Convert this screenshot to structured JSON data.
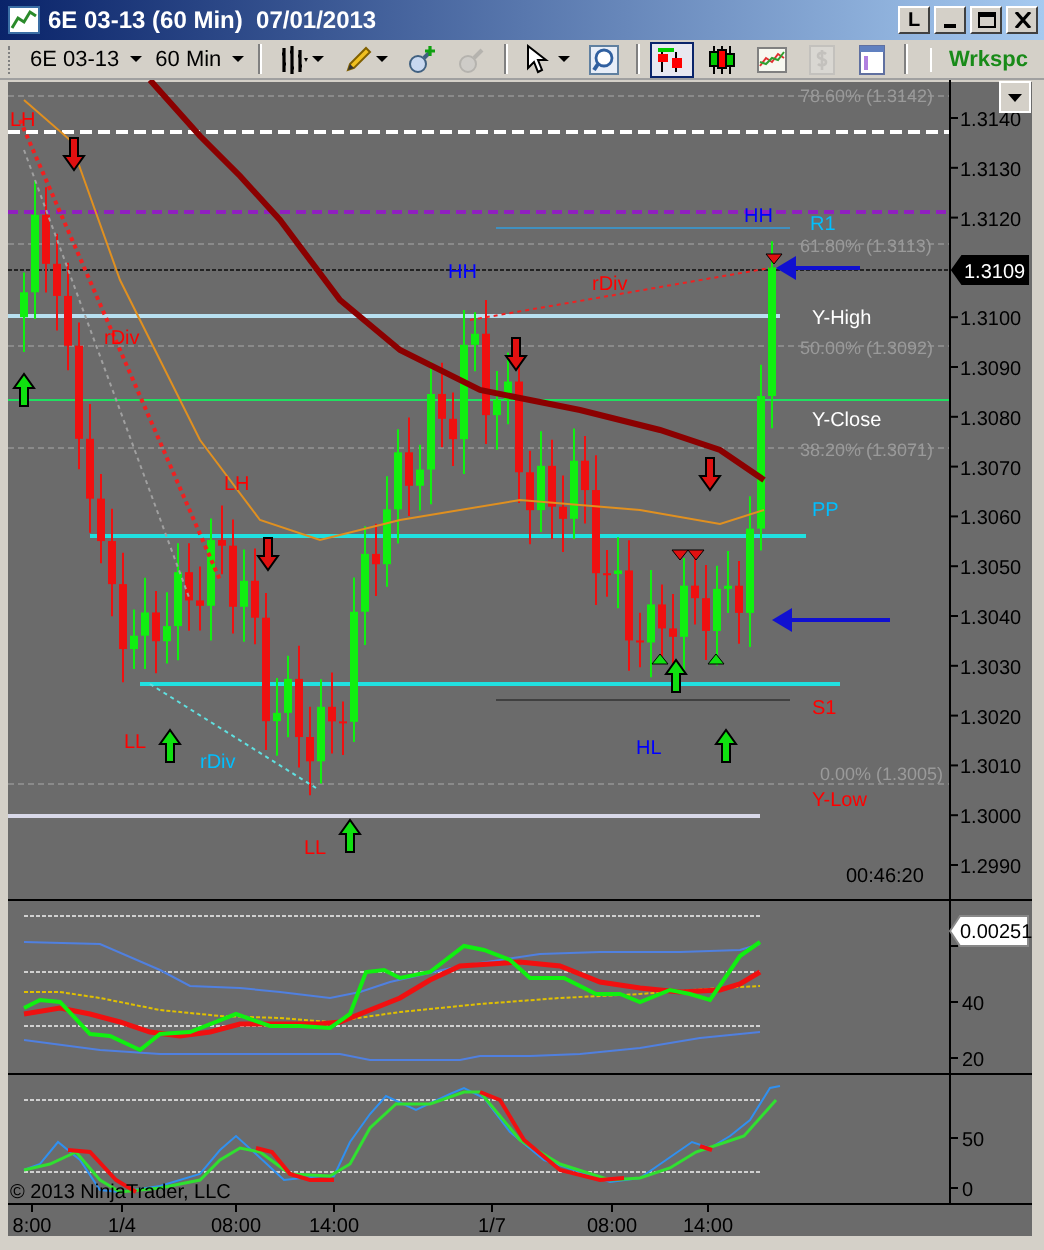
{
  "window": {
    "title": "6E 03-13 (60 Min)  07/01/2013",
    "layout_button": "L"
  },
  "toolbar": {
    "instrument": "6E 03-13",
    "interval": "60 Min",
    "workspace": "Wrkspc",
    "tools": [
      {
        "kind": "bar-type",
        "selected": false,
        "disabled": false
      },
      {
        "kind": "pencil",
        "selected": false,
        "disabled": false
      },
      {
        "kind": "zoom-in",
        "selected": false,
        "disabled": false
      },
      {
        "kind": "zoom-out",
        "selected": false,
        "disabled": true
      },
      {
        "kind": "pointer",
        "selected": false,
        "disabled": false
      },
      {
        "kind": "magnifier",
        "selected": false,
        "disabled": false
      },
      {
        "kind": "data-box",
        "selected": true,
        "disabled": false
      },
      {
        "kind": "candles",
        "selected": false,
        "disabled": false
      },
      {
        "kind": "indicators",
        "selected": false,
        "disabled": false
      },
      {
        "kind": "dollar",
        "selected": false,
        "disabled": true
      },
      {
        "kind": "properties",
        "selected": false,
        "disabled": false
      }
    ]
  },
  "price_panel": {
    "axis_labels": [
      "1.3140",
      "1.3130",
      "1.3120",
      "1.3100",
      "1.3090",
      "1.3080",
      "1.3070",
      "1.3060",
      "1.3050",
      "1.3040",
      "1.3030",
      "1.3020",
      "1.3010",
      "1.3000",
      "1.2990"
    ],
    "last_price": "1.3109",
    "timer": "00:46:20",
    "annotations": [
      {
        "text": "78.60% (1.3142)",
        "color": "#9a9a9a"
      },
      {
        "text": "LH",
        "color": "#ff0000"
      },
      {
        "text": "R1",
        "color": "#00bfff"
      },
      {
        "text": "61.80% (1.3113)",
        "color": "#9a9a9a"
      },
      {
        "text": "HH",
        "color": "#0000ff"
      },
      {
        "text": "HH",
        "color": "#0000ff"
      },
      {
        "text": "rDiv",
        "color": "#ff0000"
      },
      {
        "text": "Y-High",
        "color": "#ffffff"
      },
      {
        "text": "rDiv",
        "color": "#ff0000"
      },
      {
        "text": "50.00% (1.3092)",
        "color": "#9a9a9a"
      },
      {
        "text": "Y-Close",
        "color": "#ffffff"
      },
      {
        "text": "38.20% (1.3071)",
        "color": "#9a9a9a"
      },
      {
        "text": "LH",
        "color": "#ff0000"
      },
      {
        "text": "PP",
        "color": "#00bfff"
      },
      {
        "text": "S1",
        "color": "#ff0000"
      },
      {
        "text": "LL",
        "color": "#ff0000"
      },
      {
        "text": "rDiv",
        "color": "#00bfff"
      },
      {
        "text": "HL",
        "color": "#0000ff"
      },
      {
        "text": "0.00% (1.3005)",
        "color": "#9a9a9a"
      },
      {
        "text": "Y-Low",
        "color": "#ff0000"
      },
      {
        "text": "LL",
        "color": "#ff0000"
      }
    ]
  },
  "indicator_panels": [
    {
      "value": "0.00251",
      "axis_labels": [
        "40",
        "20"
      ]
    },
    {
      "axis_labels": [
        "50",
        "0"
      ]
    }
  ],
  "time_axis": [
    "8:00",
    "1/4",
    "08:00",
    "14:00",
    "1/7",
    "08:00",
    "14:00"
  ],
  "copyright": "© 2013 NinjaTrader, LLC"
}
